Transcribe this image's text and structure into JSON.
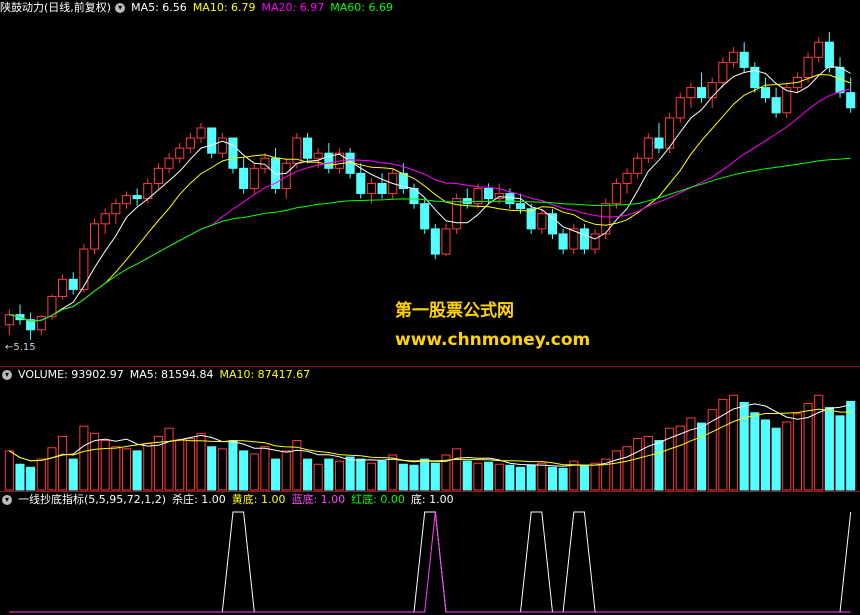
{
  "price_panel": {
    "title": "陕鼓动力(日线,前复权)",
    "ma_items": [
      {
        "label": "MA5: 6.56",
        "color": "#ffffff"
      },
      {
        "label": "MA10: 6.79",
        "color": "#ffff00"
      },
      {
        "label": "MA20: 6.97",
        "color": "#ff00ff"
      },
      {
        "label": "MA60: 6.69",
        "color": "#00ff00"
      }
    ],
    "low_marker": "←5.15"
  },
  "volume_panel": {
    "items": [
      {
        "label": "VOLUME: 93902.97",
        "color": "#ffffff"
      },
      {
        "label": "MA5: 81594.84",
        "color": "#ffffff"
      },
      {
        "label": "MA10: 87417.67",
        "color": "#ffff00"
      }
    ]
  },
  "indicator_panel": {
    "title": "一线抄底指标(5,5,95,72,1,2)",
    "items": [
      {
        "label": "杀庄: 1.00",
        "color": "#ffffff"
      },
      {
        "label": "黄底: 1.00",
        "color": "#ffff00"
      },
      {
        "label": "蓝底: 1.00",
        "color": "#ff44ff"
      },
      {
        "label": "红底: 0.00",
        "color": "#00ff00"
      },
      {
        "label": "底: 1.00",
        "color": "#ffffff"
      }
    ]
  },
  "watermark": {
    "line1": "第一股票公式网",
    "line2": "www.chnmoney.com"
  },
  "colors": {
    "up": "#ff3b3b",
    "down": "#54ffff",
    "grid": "#8b1a1a",
    "ma5": "#ffffff",
    "ma10": "#ffff00",
    "ma20": "#ff00ff",
    "ma60": "#00ff00"
  },
  "chart_data": [
    {
      "type": "candlestick",
      "price_range": [
        5.0,
        8.3
      ],
      "candles": [
        [
          5.3,
          5.45,
          5.2,
          5.4
        ],
        [
          5.4,
          5.5,
          5.3,
          5.35
        ],
        [
          5.35,
          5.42,
          5.15,
          5.25
        ],
        [
          5.25,
          5.4,
          5.2,
          5.38
        ],
        [
          5.38,
          5.6,
          5.35,
          5.58
        ],
        [
          5.58,
          5.8,
          5.55,
          5.75
        ],
        [
          5.75,
          5.82,
          5.6,
          5.65
        ],
        [
          5.65,
          6.1,
          5.62,
          6.05
        ],
        [
          6.05,
          6.35,
          6.0,
          6.3
        ],
        [
          6.3,
          6.45,
          6.2,
          6.4
        ],
        [
          6.4,
          6.55,
          6.3,
          6.5
        ],
        [
          6.5,
          6.62,
          6.45,
          6.58
        ],
        [
          6.58,
          6.65,
          6.48,
          6.55
        ],
        [
          6.55,
          6.75,
          6.5,
          6.7
        ],
        [
          6.7,
          6.9,
          6.65,
          6.85
        ],
        [
          6.85,
          7.0,
          6.8,
          6.95
        ],
        [
          6.95,
          7.1,
          6.9,
          7.05
        ],
        [
          7.05,
          7.2,
          7.0,
          7.15
        ],
        [
          7.15,
          7.3,
          7.1,
          7.25
        ],
        [
          7.25,
          7.25,
          6.95,
          7.0
        ],
        [
          7.0,
          7.2,
          6.95,
          7.15
        ],
        [
          7.15,
          7.15,
          6.8,
          6.85
        ],
        [
          6.85,
          6.95,
          6.6,
          6.65
        ],
        [
          6.65,
          6.9,
          6.6,
          6.85
        ],
        [
          6.85,
          7.0,
          6.8,
          6.95
        ],
        [
          6.95,
          7.05,
          6.6,
          6.65
        ],
        [
          6.65,
          6.95,
          6.55,
          6.9
        ],
        [
          6.9,
          7.2,
          6.85,
          7.15
        ],
        [
          7.15,
          7.2,
          6.9,
          6.95
        ],
        [
          6.95,
          7.05,
          6.85,
          7.0
        ],
        [
          7.0,
          7.1,
          6.8,
          6.85
        ],
        [
          6.85,
          7.05,
          6.8,
          7.0
        ],
        [
          7.0,
          7.05,
          6.75,
          6.8
        ],
        [
          6.8,
          6.9,
          6.55,
          6.6
        ],
        [
          6.6,
          6.75,
          6.5,
          6.7
        ],
        [
          6.7,
          6.8,
          6.55,
          6.6
        ],
        [
          6.6,
          6.85,
          6.55,
          6.8
        ],
        [
          6.8,
          6.9,
          6.6,
          6.65
        ],
        [
          6.65,
          6.7,
          6.45,
          6.5
        ],
        [
          6.5,
          6.55,
          6.2,
          6.25
        ],
        [
          6.25,
          6.3,
          5.95,
          6.0
        ],
        [
          6.0,
          6.3,
          5.98,
          6.25
        ],
        [
          6.25,
          6.6,
          6.2,
          6.55
        ],
        [
          6.55,
          6.65,
          6.45,
          6.5
        ],
        [
          6.5,
          6.7,
          6.45,
          6.65
        ],
        [
          6.65,
          6.7,
          6.5,
          6.55
        ],
        [
          6.55,
          6.7,
          6.5,
          6.6
        ],
        [
          6.6,
          6.65,
          6.45,
          6.5
        ],
        [
          6.5,
          6.6,
          6.4,
          6.45
        ],
        [
          6.45,
          6.5,
          6.2,
          6.25
        ],
        [
          6.25,
          6.45,
          6.2,
          6.4
        ],
        [
          6.4,
          6.45,
          6.15,
          6.2
        ],
        [
          6.2,
          6.25,
          6.0,
          6.05
        ],
        [
          6.05,
          6.3,
          6.0,
          6.25
        ],
        [
          6.25,
          6.3,
          6.0,
          6.05
        ],
        [
          6.05,
          6.25,
          6.0,
          6.2
        ],
        [
          6.2,
          6.55,
          6.15,
          6.5
        ],
        [
          6.5,
          6.75,
          6.45,
          6.7
        ],
        [
          6.7,
          6.85,
          6.6,
          6.8
        ],
        [
          6.8,
          7.0,
          6.75,
          6.95
        ],
        [
          6.95,
          7.2,
          6.9,
          7.15
        ],
        [
          7.15,
          7.3,
          7.0,
          7.05
        ],
        [
          7.05,
          7.4,
          7.0,
          7.35
        ],
        [
          7.35,
          7.6,
          7.3,
          7.55
        ],
        [
          7.55,
          7.7,
          7.45,
          7.65
        ],
        [
          7.65,
          7.8,
          7.5,
          7.55
        ],
        [
          7.55,
          7.75,
          7.45,
          7.7
        ],
        [
          7.7,
          7.95,
          7.65,
          7.9
        ],
        [
          7.9,
          8.05,
          7.85,
          8.0
        ],
        [
          8.0,
          8.1,
          7.8,
          7.85
        ],
        [
          7.85,
          7.9,
          7.6,
          7.65
        ],
        [
          7.65,
          7.75,
          7.5,
          7.55
        ],
        [
          7.55,
          7.65,
          7.35,
          7.4
        ],
        [
          7.4,
          7.7,
          7.35,
          7.65
        ],
        [
          7.65,
          7.8,
          7.6,
          7.75
        ],
        [
          7.75,
          8.0,
          7.7,
          7.95
        ],
        [
          7.95,
          8.15,
          7.9,
          8.1
        ],
        [
          8.1,
          8.2,
          7.8,
          7.85
        ],
        [
          7.85,
          7.95,
          7.55,
          7.6
        ],
        [
          7.6,
          7.75,
          7.4,
          7.45
        ]
      ]
    },
    {
      "type": "bar",
      "volume_max": 100000,
      "volumes": [
        38000,
        25000,
        22000,
        30000,
        41000,
        52000,
        30000,
        62000,
        55000,
        48000,
        42000,
        40000,
        38000,
        45000,
        52000,
        60000,
        48000,
        50000,
        55000,
        42000,
        40000,
        48000,
        38000,
        35000,
        42000,
        30000,
        38000,
        48000,
        30000,
        25000,
        30000,
        28000,
        32000,
        30000,
        26000,
        28000,
        34000,
        25000,
        24000,
        30000,
        26000,
        34000,
        40000,
        28000,
        26000,
        27000,
        25000,
        24000,
        22000,
        24000,
        26000,
        22000,
        21000,
        28000,
        24000,
        26000,
        30000,
        38000,
        42000,
        50000,
        52000,
        48000,
        60000,
        62000,
        70000,
        65000,
        78000,
        88000,
        92000,
        85000,
        75000,
        68000,
        60000,
        66000,
        74000,
        84000,
        92000,
        80000,
        72000,
        86000
      ]
    },
    {
      "type": "line",
      "series": [
        {
          "name": "杀庄",
          "values": [
            0,
            0,
            0,
            0,
            0,
            0,
            0,
            0,
            0,
            0,
            0,
            0,
            0,
            0,
            0,
            0,
            0,
            0,
            0,
            0,
            0,
            1,
            1,
            0,
            0,
            0,
            0,
            0,
            0,
            0,
            0,
            0,
            0,
            0,
            0,
            0,
            0,
            0,
            0,
            1,
            1,
            0,
            0,
            0,
            0,
            0,
            0,
            0,
            0,
            1,
            1,
            0,
            0,
            1,
            1,
            0,
            0,
            0,
            0,
            0,
            0,
            0,
            0,
            0,
            0,
            0,
            0,
            0,
            0,
            0,
            0,
            0,
            0,
            0,
            0,
            0,
            0,
            0,
            0,
            1
          ]
        },
        {
          "name": "蓝底",
          "values": [
            0,
            0,
            0,
            0,
            0,
            0,
            0,
            0,
            0,
            0,
            0,
            0,
            0,
            0,
            0,
            0,
            0,
            0,
            0,
            0,
            0,
            0,
            0,
            0,
            0,
            0,
            0,
            0,
            0,
            0,
            0,
            0,
            0,
            0,
            0,
            0,
            0,
            0,
            0,
            0,
            1,
            0,
            0,
            0,
            0,
            0,
            0,
            0,
            0,
            0,
            0,
            0,
            0,
            0,
            0,
            0,
            0,
            0,
            0,
            0,
            0,
            0,
            0,
            0,
            0,
            0,
            0,
            0,
            0,
            0,
            0,
            0,
            0,
            0,
            0,
            0,
            0,
            0,
            0,
            0
          ]
        }
      ]
    }
  ]
}
